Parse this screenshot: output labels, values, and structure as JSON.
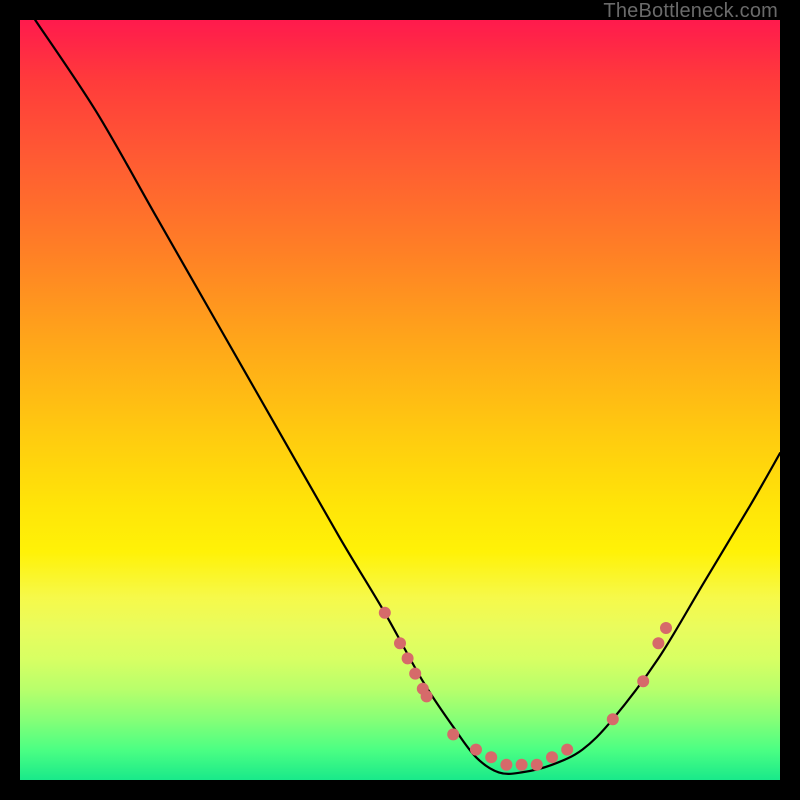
{
  "watermark": "TheBottleneck.com",
  "chart_data": {
    "type": "line",
    "title": "",
    "xlabel": "",
    "ylabel": "",
    "xlim": [
      0,
      100
    ],
    "ylim": [
      0,
      100
    ],
    "curve": {
      "name": "bottleneck-curve",
      "x": [
        2,
        10,
        18,
        26,
        34,
        42,
        48,
        53,
        57,
        60,
        63,
        66,
        70,
        74,
        78,
        84,
        90,
        96,
        100
      ],
      "y": [
        100,
        88,
        74,
        60,
        46,
        32,
        22,
        13,
        7,
        3,
        1,
        1,
        2,
        4,
        8,
        16,
        26,
        36,
        43
      ]
    },
    "dots": {
      "name": "highlight-dots",
      "color": "#d66a6a",
      "radius_px": 6,
      "points": [
        {
          "x": 48,
          "y": 22
        },
        {
          "x": 50,
          "y": 18
        },
        {
          "x": 51,
          "y": 16
        },
        {
          "x": 52,
          "y": 14
        },
        {
          "x": 53,
          "y": 12
        },
        {
          "x": 53.5,
          "y": 11
        },
        {
          "x": 57,
          "y": 6
        },
        {
          "x": 60,
          "y": 4
        },
        {
          "x": 62,
          "y": 3
        },
        {
          "x": 64,
          "y": 2
        },
        {
          "x": 66,
          "y": 2
        },
        {
          "x": 68,
          "y": 2
        },
        {
          "x": 70,
          "y": 3
        },
        {
          "x": 72,
          "y": 4
        },
        {
          "x": 78,
          "y": 8
        },
        {
          "x": 82,
          "y": 13
        },
        {
          "x": 84,
          "y": 18
        },
        {
          "x": 85,
          "y": 20
        }
      ]
    },
    "gradient_stops": [
      {
        "pos": 0,
        "color": "#ff1a4d"
      },
      {
        "pos": 30,
        "color": "#ff7e26"
      },
      {
        "pos": 55,
        "color": "#ffcc0f"
      },
      {
        "pos": 76,
        "color": "#e9fc5d"
      },
      {
        "pos": 92,
        "color": "#86ff77"
      },
      {
        "pos": 100,
        "color": "#19e98a"
      }
    ]
  }
}
